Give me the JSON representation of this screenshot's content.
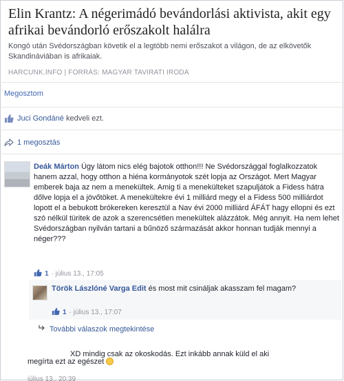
{
  "card": {
    "title": "Elin Krantz: A négerimádó bevándorlási aktivista, akit egy afrikai bevándorló erőszakolt halálra",
    "description": "Kongó után Svédországban követik el a legtöbb nemi erőszakot a világon, de az elkövetők Skandináviában is afrikaiak.",
    "source": "HARCUNK.INFO | FORRÁS: MAGYAR TAVIRATI IRODA"
  },
  "actions": {
    "share_label": "Megosztom",
    "liker_name": "Juci Gondáné",
    "likes_text": "kedveli ezt.",
    "shares_text": "1 megosztás"
  },
  "comments": [
    {
      "author": "Deák Márton",
      "text": "Úgy látom nics elég bajotok otthon!!! Ne Svédországgal foglalkozzatok hanem azzal, hogy otthon a hiéna kormányotok szét lopja az Országot. Mert Magyar emberek baja az nem a menekültek. Amig ti a menekülteket szapuljátok a Fidess hátra dőlve lopja el a jövőtöket. A menekültekre évi 1 milliárd megy el a Fidess 500 milliárdot lopott el a bebukott brókereken keresztül a Nav évi 2000 milliárd ÁFÁT hagy ellopni és ezt szó nélkül türitek de azok a szerencsétlen menekültek alázzátok. Még annyit. Ha nem lehet Svédországban nyilván tartani a bűnöző származását akkor honnan tudják mennyi a néger???",
      "likes": "1",
      "time": "július 13., 17:05"
    },
    {
      "author": "Török Lászlóné Varga Edit",
      "text": "és most mit csináljak akasszam fel magam?",
      "likes": "1",
      "time": "július 13., 17:07"
    }
  ],
  "more_replies": "További válaszok megtekintése",
  "comment3": {
    "line1": "XD mindig csak az okoskodás. Ezt inkább annak küld el aki",
    "line2": "megírta ezt az egészet",
    "time": "július 13., 20:39"
  },
  "colors": {
    "link": "#365899",
    "like_blue": "#4267b2",
    "muted": "#90949c"
  },
  "icons": [
    "thumbs-up-icon",
    "share-arrow-icon",
    "reply-arrow-icon",
    "smile-emoji-icon"
  ]
}
